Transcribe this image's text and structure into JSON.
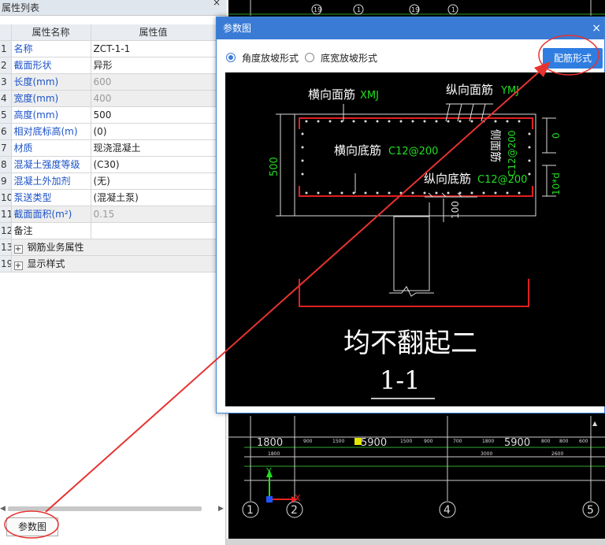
{
  "panel": {
    "title": "属性列表",
    "close": "×",
    "headers": {
      "name": "属性名称",
      "value": "属性值"
    },
    "rows": [
      {
        "num": "1",
        "name": "名称",
        "value": "ZCT-1-1"
      },
      {
        "num": "2",
        "name": "截面形状",
        "value": "异形"
      },
      {
        "num": "3",
        "name": "长度(mm)",
        "value": "600"
      },
      {
        "num": "4",
        "name": "宽度(mm)",
        "value": "400"
      },
      {
        "num": "5",
        "name": "高度(mm)",
        "value": "500"
      },
      {
        "num": "6",
        "name": "相对底标高(m)",
        "value": "(0)"
      },
      {
        "num": "7",
        "name": "材质",
        "value": "现浇混凝土"
      },
      {
        "num": "8",
        "name": "混凝土强度等级",
        "value": "(C30)"
      },
      {
        "num": "9",
        "name": "混凝土外加剂",
        "value": "(无)"
      },
      {
        "num": "10",
        "name": "泵送类型",
        "value": "(混凝土泵)"
      },
      {
        "num": "11",
        "name": "截面面积(m²)",
        "value": "0.15"
      },
      {
        "num": "12",
        "name": "备注",
        "value": ""
      },
      {
        "num": "13",
        "name": "钢筋业务属性",
        "value": ""
      },
      {
        "num": "19",
        "name": "显示样式",
        "value": ""
      }
    ],
    "expander": "+",
    "bottom_button": "参数图"
  },
  "dialog": {
    "title": "参数图",
    "close": "×",
    "radio_angle": "角度放坡形式",
    "radio_width": "底宽放坡形式",
    "config_button": "配筋形式"
  },
  "diagram": {
    "label_top_horizontal": "横向面筋",
    "label_top_horizontal_code": "XMJ",
    "label_top_longitudinal": "纵向面筋",
    "label_top_longitudinal_code": "YMJ",
    "label_bottom_horizontal": "横向底筋",
    "label_bottom_horizontal_code": "C12@200",
    "label_bottom_longitudinal": "纵向底筋",
    "label_bottom_longitudinal_code": "C12@200",
    "label_side": "侧面筋",
    "label_side_code": "C12@200",
    "dim_height": "500",
    "dim_zero": "0",
    "dim_10d": "10*d",
    "dim_100": "100",
    "caption": "均不翻起二",
    "section": "1-1"
  },
  "cad": {
    "dims": [
      "1800",
      "900",
      "1500",
      "1500",
      "900",
      "700",
      "1800",
      "5900",
      "800",
      "800",
      "600",
      "3000",
      "2600"
    ],
    "big_dims": [
      "1800",
      "5900",
      "5900"
    ],
    "axes": [
      "1",
      "2",
      "4",
      "5"
    ],
    "top_tags": [
      "19",
      "1",
      "19",
      "1"
    ],
    "axis_y": "Y",
    "axis_x": "X"
  },
  "colors": {
    "accent": "#3a7bd5",
    "annotation": "#e8322f",
    "rebar": "#e02020",
    "green_text": "#22dd22",
    "cad_yellow": "#e6e600"
  }
}
